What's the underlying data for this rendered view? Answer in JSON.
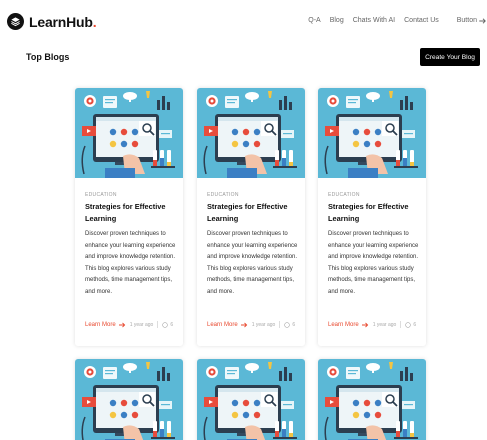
{
  "brand": {
    "name": "LearnHub",
    "dot": "."
  },
  "nav": {
    "links": [
      "Q-A",
      "Blog",
      "Chats With AI",
      "Contact Us"
    ],
    "button_label": "Button"
  },
  "page": {
    "section_title": "Top Blogs",
    "create_button": "Create Your Blog"
  },
  "cards": [
    {
      "category": "EDUCATION",
      "title": "Strategies for Effective Learning",
      "description": "Discover proven techniques to enhance your learning experience and improve knowledge retention. This blog explores various study methods, time management tips, and more.",
      "link_label": "Learn More",
      "time": "1 year ago",
      "comments": "6"
    },
    {
      "category": "EDUCATION",
      "title": "Strategies for Effective Learning",
      "description": "Discover proven techniques to enhance your learning experience and improve knowledge retention. This blog explores various study methods, time management tips, and more.",
      "link_label": "Learn More",
      "time": "1 year ago",
      "comments": "6"
    },
    {
      "category": "EDUCATION",
      "title": "Strategies for Effective Learning",
      "description": "Discover proven techniques to enhance your learning experience and improve knowledge retention. This blog explores various study methods, time management tips, and more.",
      "link_label": "Learn More",
      "time": "1 year ago",
      "comments": "6"
    }
  ],
  "colors": {
    "accent": "#e8492f",
    "thumb_bg": "#5bb8d6"
  }
}
